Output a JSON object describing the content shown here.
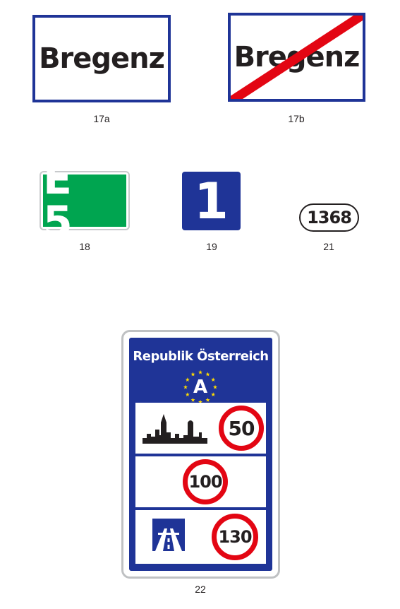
{
  "colors": {
    "blue": "#1f3497",
    "green": "#00a550",
    "red": "#e30613",
    "grey": "#bfc1c3",
    "black": "#231f20"
  },
  "signs": {
    "town_entry": {
      "text": "Bregenz",
      "caption": "17a"
    },
    "town_exit": {
      "text": "Bregenz",
      "caption": "17b"
    },
    "european_route": {
      "text": "E 5",
      "caption": "18"
    },
    "route_number": {
      "text": "1",
      "caption": "19"
    },
    "road_number": {
      "text": "1368",
      "caption": "21"
    },
    "national_border": {
      "title": "Republik Österreich",
      "country_code": "A",
      "urban_limit": "50",
      "rural_limit": "100",
      "motorway_limit": "130",
      "caption": "22"
    }
  }
}
